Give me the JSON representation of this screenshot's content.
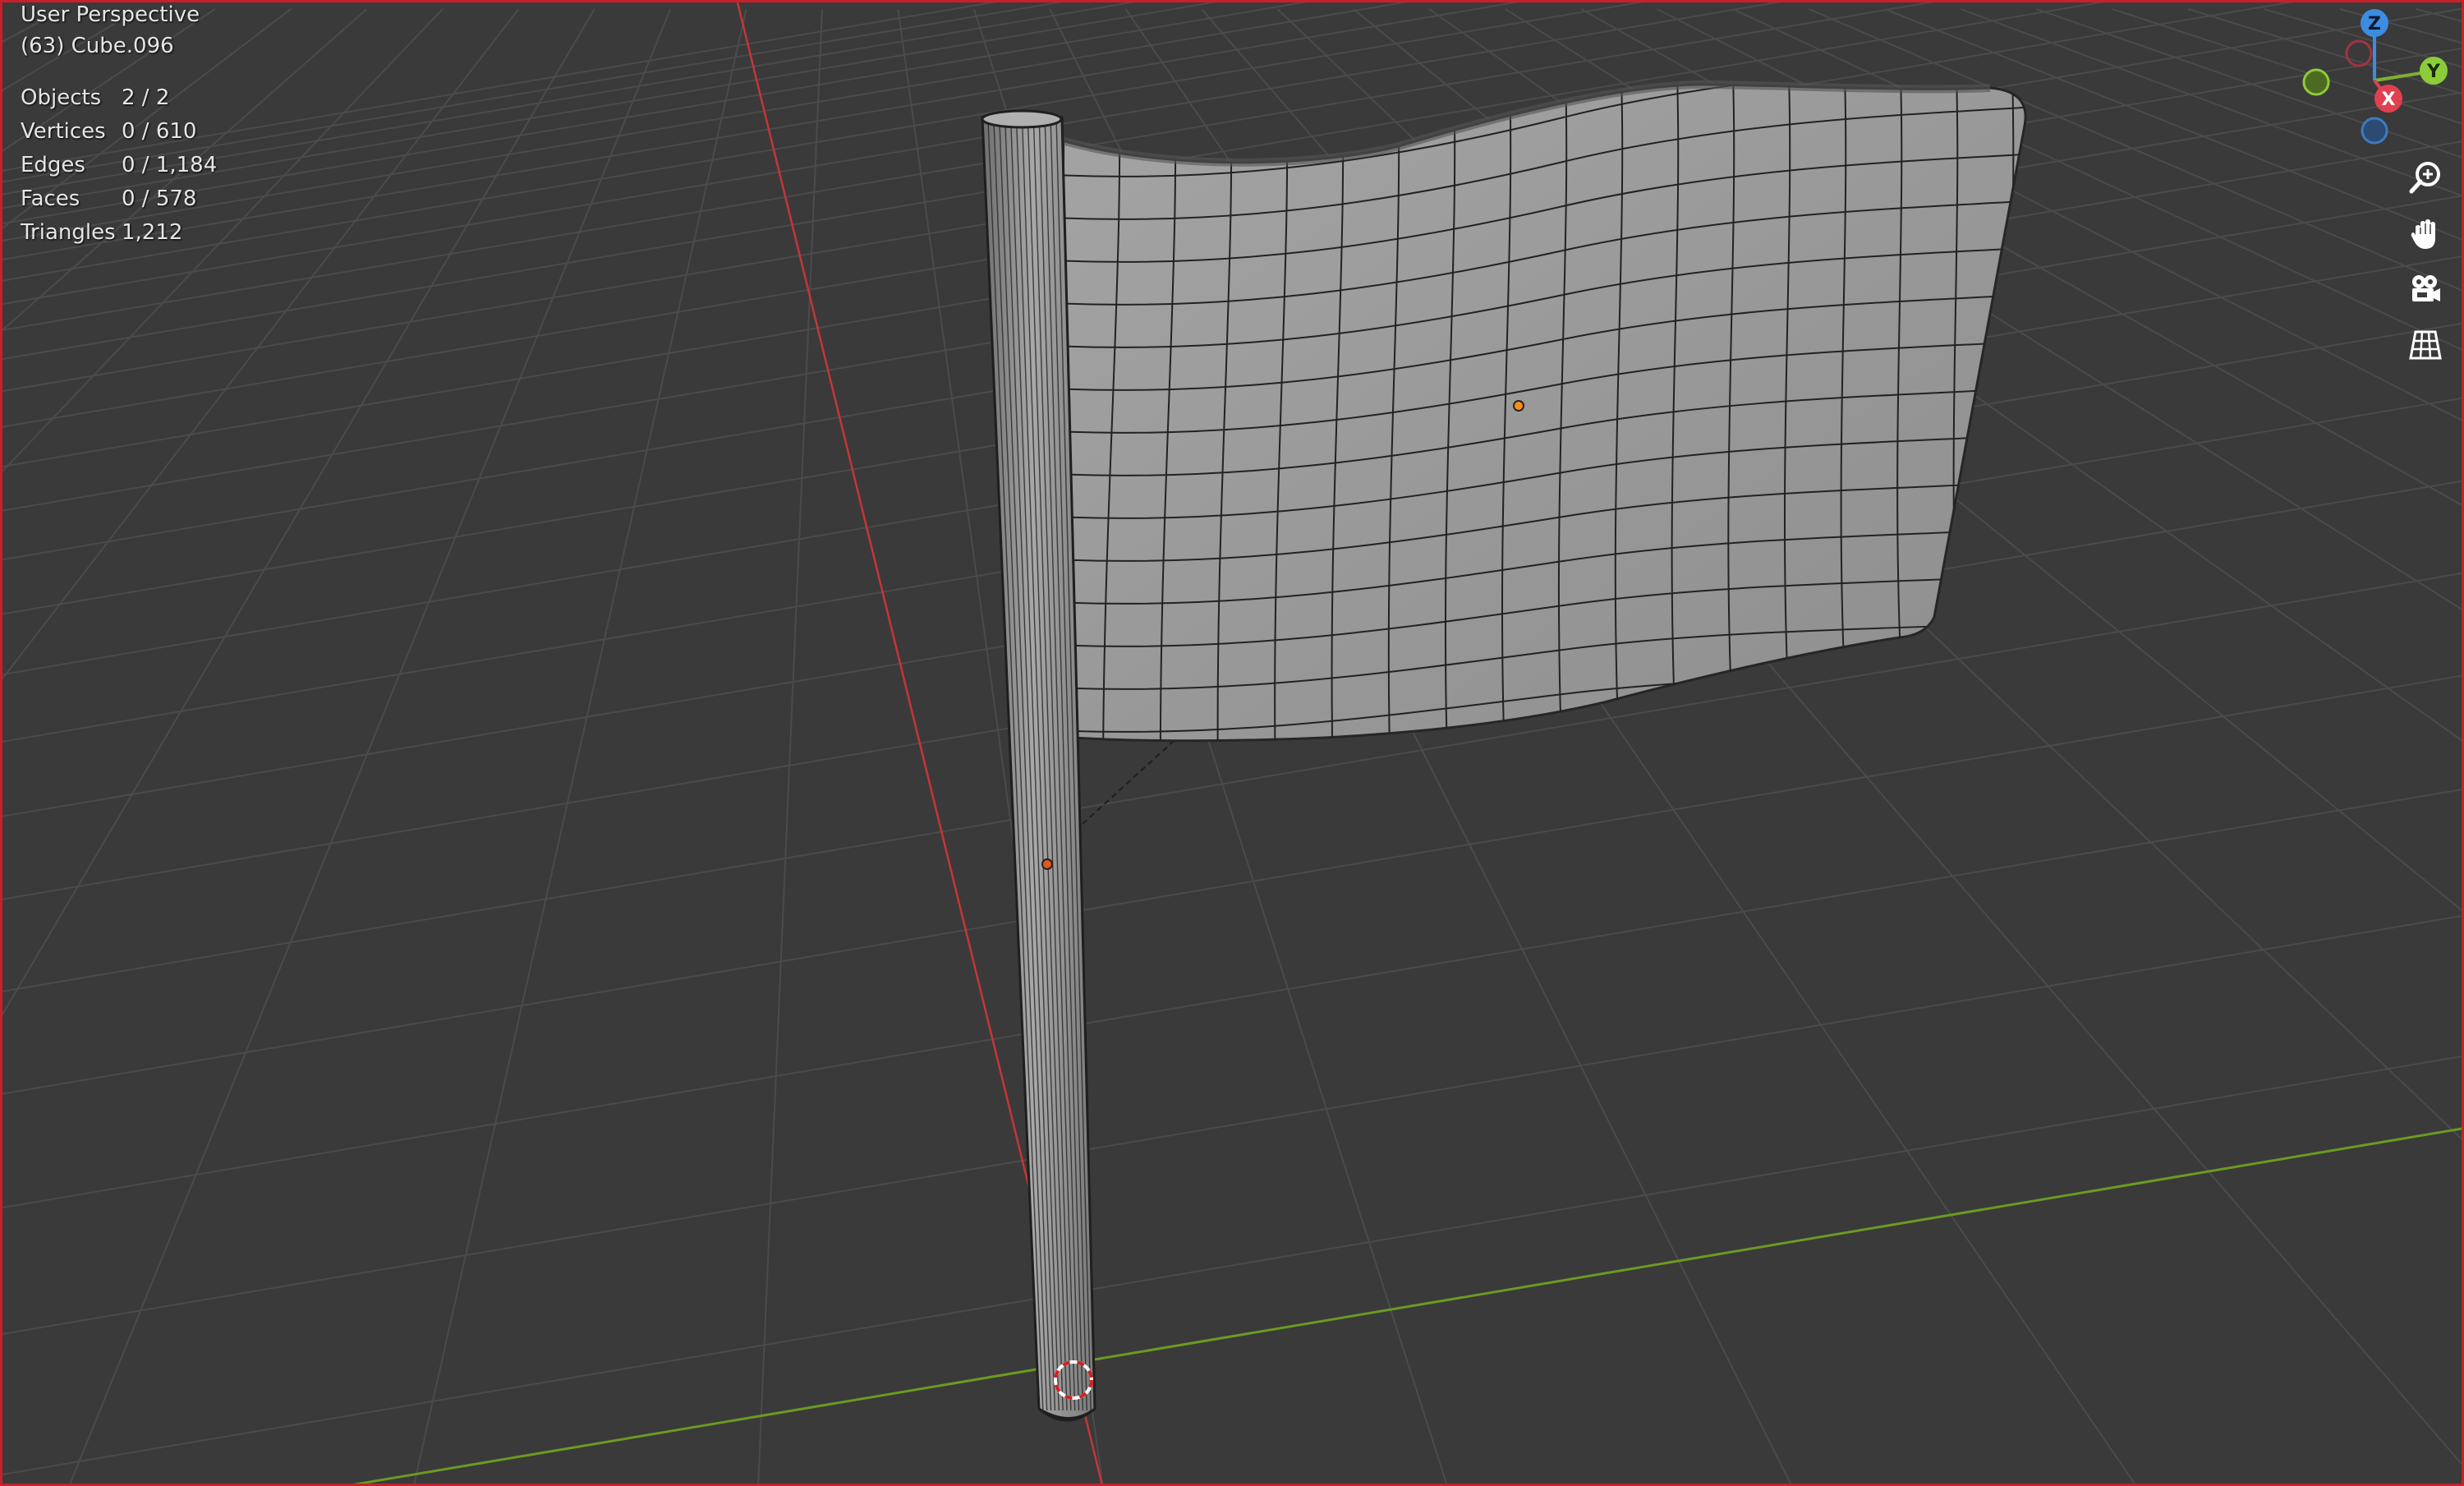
{
  "viewport": {
    "view_name": "User Perspective",
    "object_name": "(63) Cube.096"
  },
  "stats": [
    {
      "label": "Objects",
      "value": "2 / 2"
    },
    {
      "label": "Vertices",
      "value": "0 / 610"
    },
    {
      "label": "Edges",
      "value": "0 / 1,184"
    },
    {
      "label": "Faces",
      "value": "0 / 578"
    },
    {
      "label": "Triangles",
      "value": "1,212"
    }
  ],
  "gizmo": {
    "z_label": "Z",
    "y_label": "Y",
    "x_label": "X"
  },
  "nav_tools": [
    {
      "name": "zoom-icon"
    },
    {
      "name": "pan-hand-icon"
    },
    {
      "name": "camera-icon"
    },
    {
      "name": "grid-icon"
    }
  ],
  "colors": {
    "background": "#3a3a3a",
    "grid_line": "#4b4b4b",
    "x_axis": "#c73535",
    "y_axis": "#6b9a22",
    "border": "#c8202a",
    "mesh_fill": "#9a9a9a",
    "wire": "#222222",
    "origin_dot": "#ff8c1a"
  }
}
